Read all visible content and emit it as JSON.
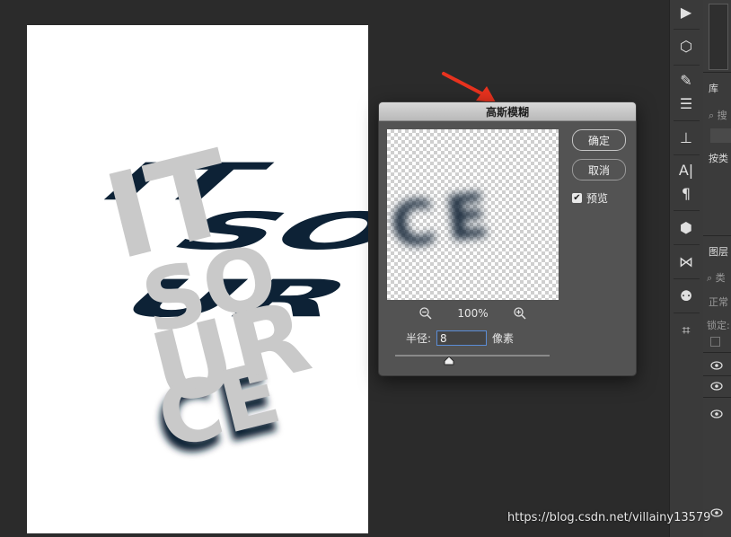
{
  "canvas": {
    "words": [
      "IT",
      "SO",
      "UR",
      "CE"
    ]
  },
  "dialog": {
    "title": "高斯模糊",
    "ok_label": "确定",
    "cancel_label": "取消",
    "preview_label": "预览",
    "preview_checked": true,
    "preview_text": "CE",
    "zoom_level": "100%",
    "radius_label": "半径:",
    "radius_value": "8",
    "radius_unit": "像素",
    "slider_position_fraction": 0.35
  },
  "side_panel": {
    "library_label": "库",
    "search_placeholder": "搜",
    "category_label": "按类",
    "layers_label": "图层",
    "layer_search": "类",
    "blend_mode": "正常",
    "lock_label": "锁定:"
  },
  "watermark": "https://blog.csdn.net/villainy13579",
  "colors": {
    "arrow": "#e8321e",
    "shadow": "#0d2236",
    "text": "#c9c9c9"
  }
}
